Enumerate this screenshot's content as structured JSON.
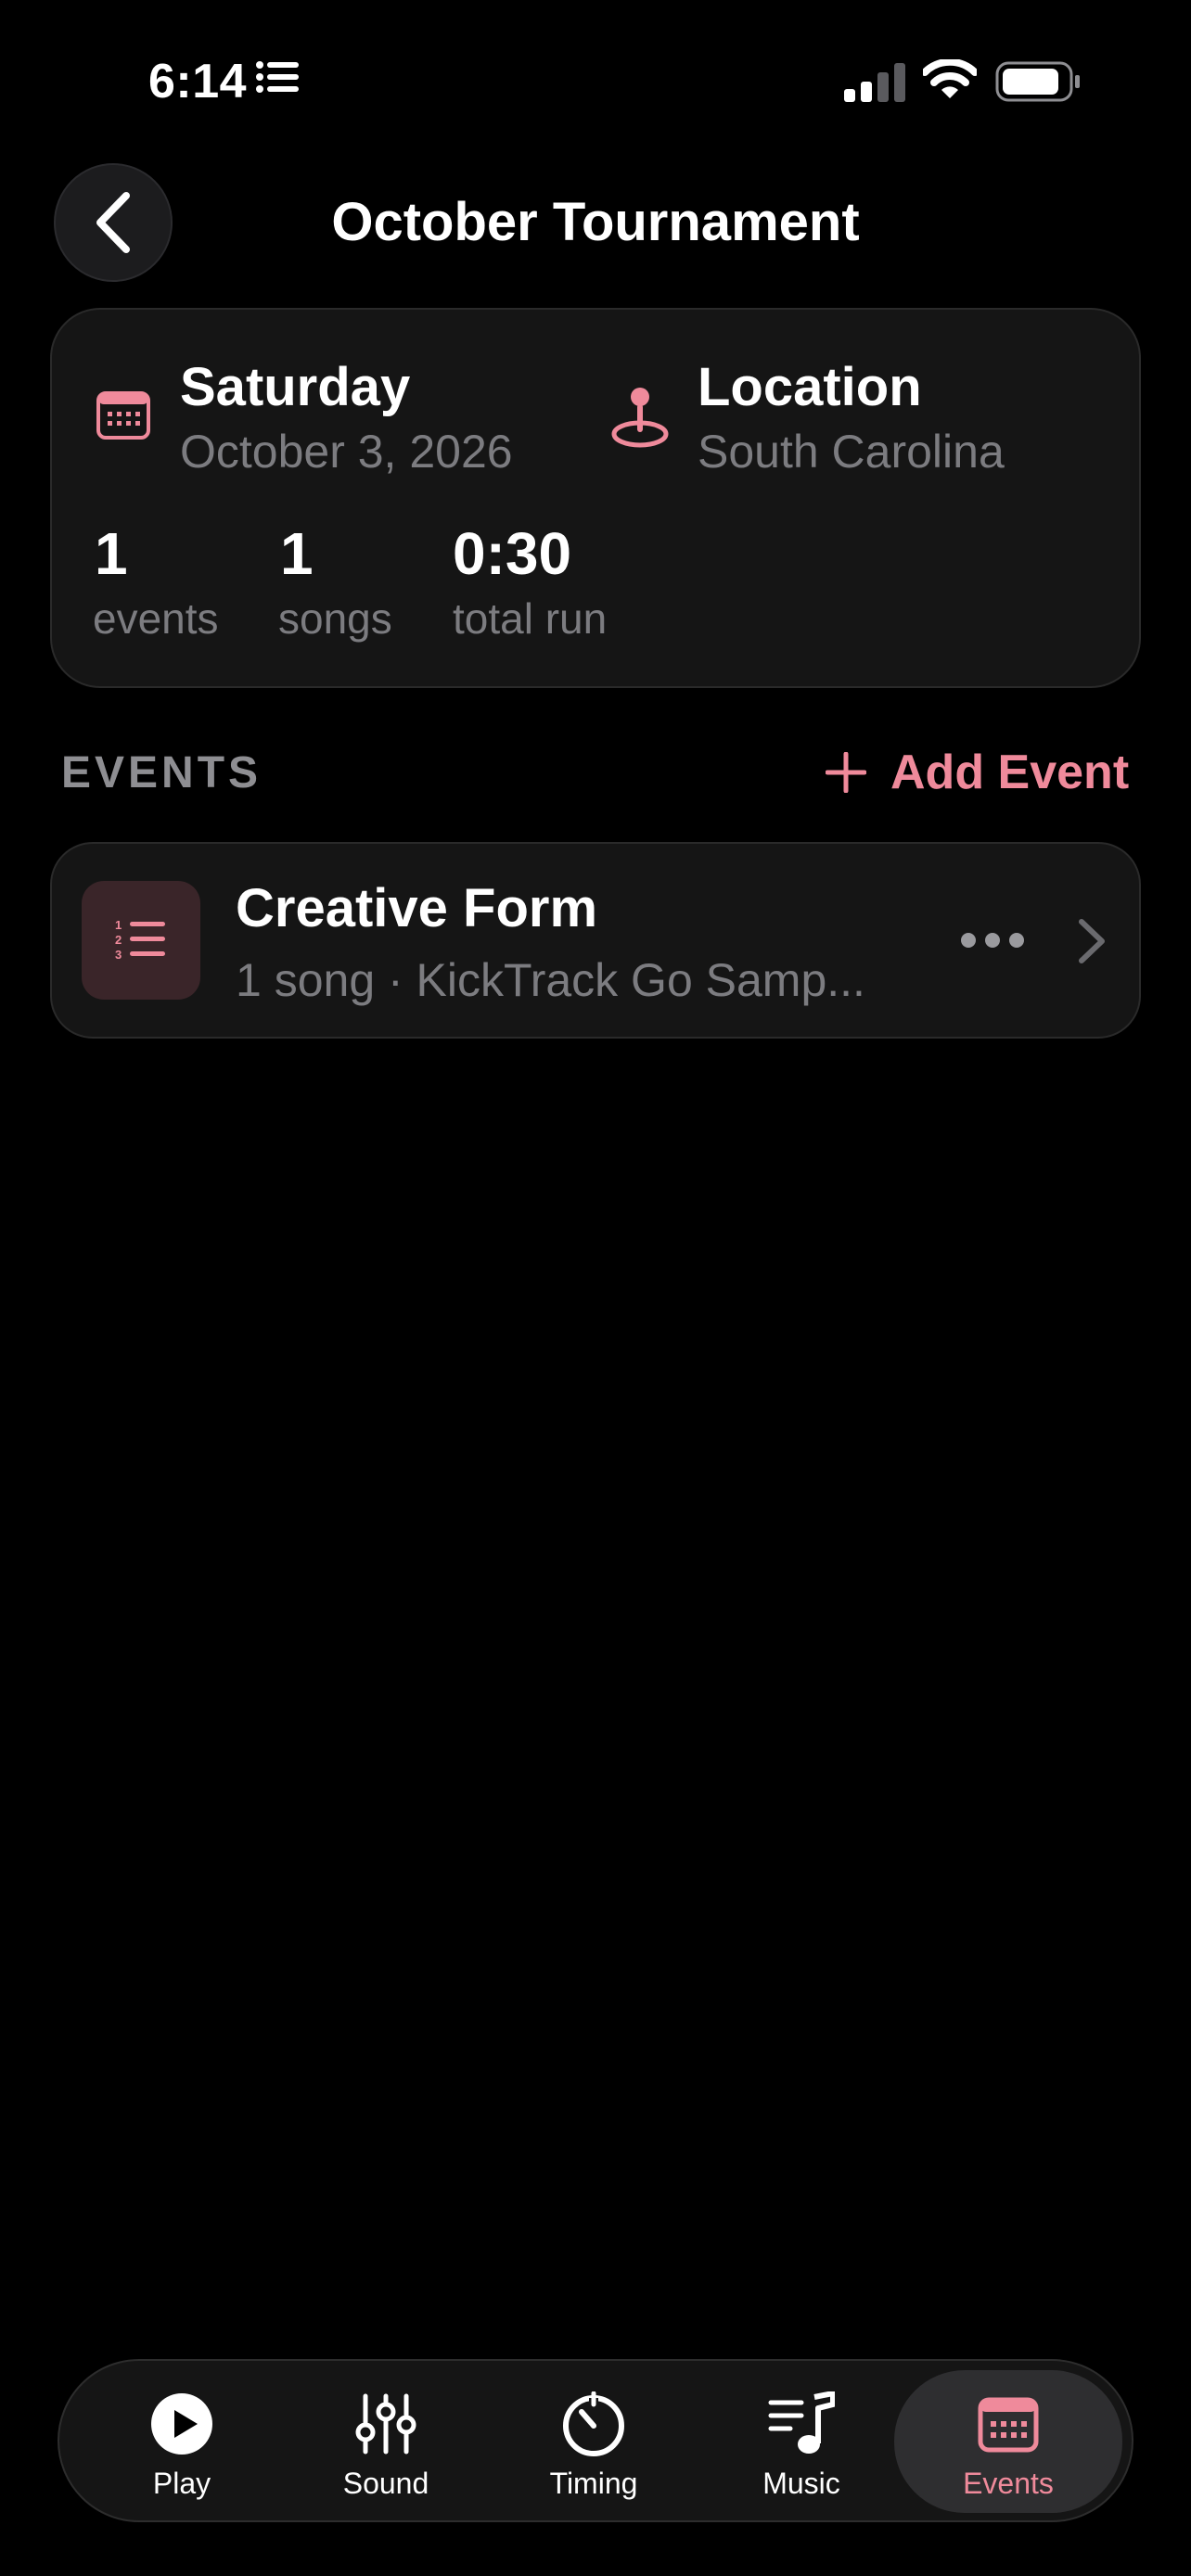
{
  "status_bar": {
    "time": "6:14"
  },
  "header": {
    "title": "October Tournament"
  },
  "summary": {
    "day": "Saturday",
    "date": "October 3, 2026",
    "location_title": "Location",
    "location_value": "South Carolina",
    "stats": [
      {
        "value": "1",
        "label": "events"
      },
      {
        "value": "1",
        "label": "songs"
      },
      {
        "value": "0:30",
        "label": "total run"
      }
    ]
  },
  "events_section": {
    "title": "EVENTS",
    "add_label": "Add Event",
    "items": [
      {
        "title": "Creative Form",
        "subtitle": "1 song · KickTrack Go Samp..."
      }
    ]
  },
  "tab_bar": {
    "tabs": [
      {
        "label": "Play",
        "icon": "play-icon"
      },
      {
        "label": "Sound",
        "icon": "sliders-icon"
      },
      {
        "label": "Timing",
        "icon": "timer-icon"
      },
      {
        "label": "Music",
        "icon": "music-icon"
      },
      {
        "label": "Events",
        "icon": "calendar-icon"
      }
    ],
    "active": "Events"
  },
  "colors": {
    "accent": "#ef8a9b",
    "background": "#000000",
    "card": "#151515",
    "secondary_text": "#7c7c80"
  }
}
